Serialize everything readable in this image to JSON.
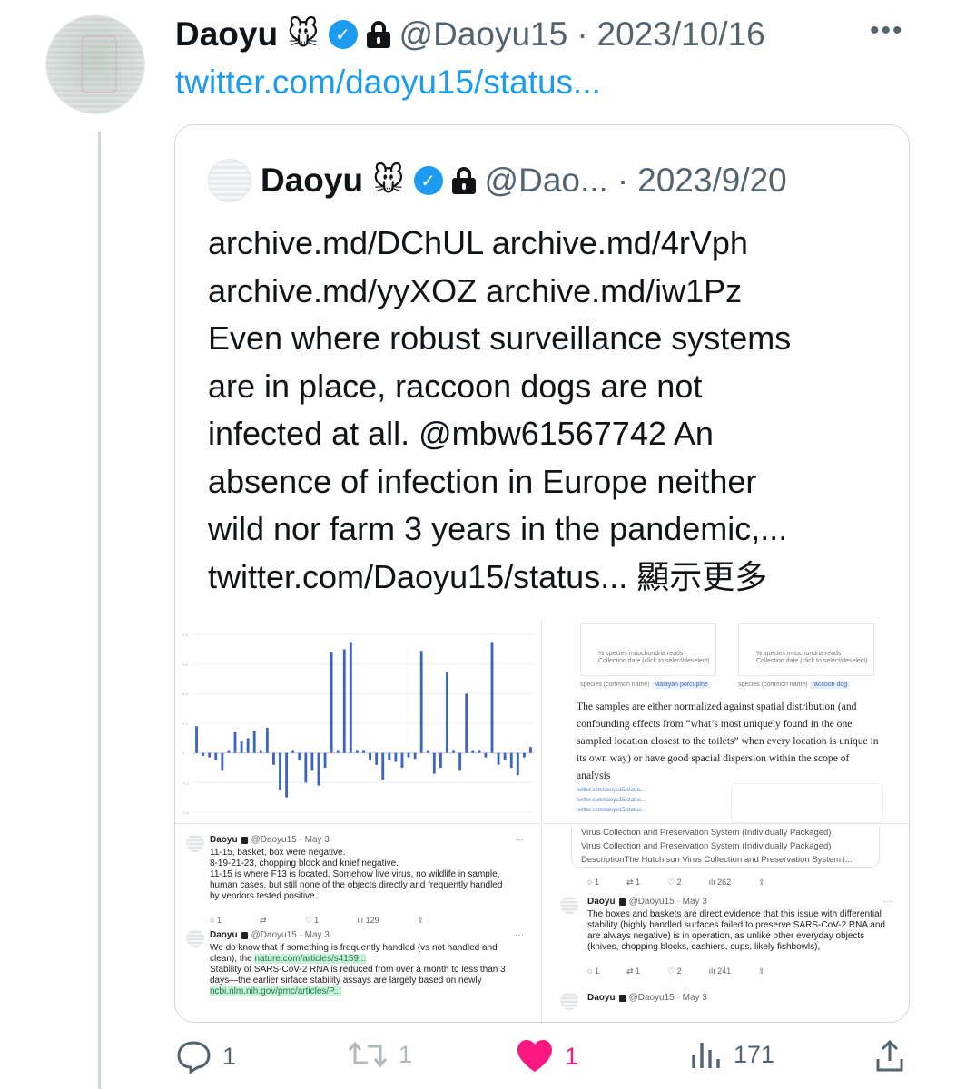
{
  "tweet": {
    "name": "Daoyu",
    "emoji": "🐭",
    "handle": "@Daoyu15",
    "separator": "·",
    "date": "2023/10/16",
    "more_icon": "more-horizontal-icon",
    "link": "twitter.com/daoyu15/status...",
    "counts": {
      "replies": "1",
      "retweets": "1",
      "likes": "1",
      "views": "171"
    },
    "colors": {
      "accent": "#1d9bf0",
      "like": "#f91880",
      "muted": "#536471"
    }
  },
  "quote": {
    "name": "Daoyu",
    "emoji": "🐭",
    "handle": "@Dao...",
    "separator": "·",
    "date": "2023/9/20",
    "text_lines": [
      "archive.md/DChUL archive.md/4rVph",
      "archive.md/yyXOZ archive.md/iw1Pz",
      "Even where robust surveillance systems",
      "are in place, raccoon dogs are not",
      "infected at all. @mbw61567742 An",
      "absence of infection in Europe neither",
      "wild nor farm 3 years in the pandemic,...",
      "twitter.com/Daoyu15/status... 顯示更多"
    ]
  },
  "media": {
    "paper_labels": {
      "axis_label": "% species mitochondria reads",
      "collection_date": "Collection date (click to select/deselect)",
      "species_label": "species (common name)",
      "species_left": "Malayan porcupine",
      "species_right": "raccoon dog"
    },
    "paper_text": "The samples are either normalized against spatial distribution (and confounding effects from “what’s most uniquely found in the one sampled location closest to the toilets” when every location is unique in its own way) or have good spacial dispersion within the scope of analysis",
    "paper_links": [
      "twitter.com/daoyu15/status...",
      "twitter.com/daoyu15/status...",
      "twitter.com/daoyu15/status..."
    ],
    "tweet_a": {
      "name": "Daoyu",
      "handle": "@Daoyu15 · May 3",
      "lines": [
        "11-15, basket, box were negative.",
        "8-19-21-23, chopping block and knief negative.",
        "11-15 is where F13 is located. Somehow live virus, no wildlife in sample,",
        "human cases, but still none of the objects directly and frequently handled",
        "by vendors tested positive."
      ],
      "counts": [
        "1",
        "",
        "1",
        "129"
      ]
    },
    "tweet_b": {
      "name": "Daoyu",
      "handle": "@Daoyu15 · May 3",
      "line1": "We do know that if something is frequently handled (vs not handled and",
      "line2_prefix": "clean), the",
      "link1": "nature.com/articles/s4159...",
      "line3": "Stability of SARS-CoV-2 RNA is reduced from over a month to less than 3",
      "line4": "days—the earlier sirface stability assays are largely based on newly",
      "link2": "ncbi.nlm.nih.gov/pmc/articles/P..."
    },
    "tweet_c": {
      "ext_lines": [
        "Virus Collection and Preservation System (Individually Packaged)",
        "Virus Collection and Preservation System (Individually Packaged)",
        "DescriptionThe Hutchison Virus Collection and Preservation System i..."
      ],
      "counts": [
        "1",
        "1",
        "2",
        "262"
      ]
    },
    "tweet_d": {
      "name": "Daoyu",
      "handle": "@Daoyu15 · May 3",
      "lines": [
        "The boxes and baskets are direct evidence that this issue with differential",
        "stability (highly handled surfaces failed to preserve SARS-CoV-2 RNA and",
        "are always negative) is in operation, as unlike other everyday objects",
        "(knives, chopping blocks, cashiers, cups, likely fishbowls),"
      ],
      "counts": [
        "1",
        "1",
        "2",
        "241"
      ]
    },
    "tweet_e": {
      "name": "Daoyu",
      "handle": "@Daoyu15 · May 3"
    }
  },
  "chart_data": {
    "type": "bar",
    "title": "",
    "xlabel": "",
    "ylabel": "",
    "ylim": [
      -0.4,
      0.85
    ],
    "yticks": [
      -0.4,
      -0.2,
      0,
      0.2,
      0.4,
      0.6,
      0.8
    ],
    "values": [
      0.18,
      -0.02,
      -0.03,
      -0.05,
      -0.12,
      0.02,
      0.14,
      0.08,
      0.1,
      0.15,
      0.02,
      0.17,
      -0.08,
      -0.25,
      -0.3,
      0.02,
      -0.05,
      -0.2,
      -0.12,
      -0.22,
      -0.1,
      0.68,
      0.02,
      0.7,
      0.75,
      0.02,
      0.02,
      -0.05,
      -0.08,
      -0.18,
      -0.05,
      -0.06,
      -0.1,
      -0.03,
      -0.04,
      0.69,
      0.02,
      -0.14,
      -0.1,
      0.55,
      0.02,
      -0.12,
      0.4,
      0.02,
      0.02,
      -0.03,
      0.75,
      -0.08,
      -0.05,
      -0.1,
      -0.15,
      -0.03,
      0.04
    ]
  }
}
